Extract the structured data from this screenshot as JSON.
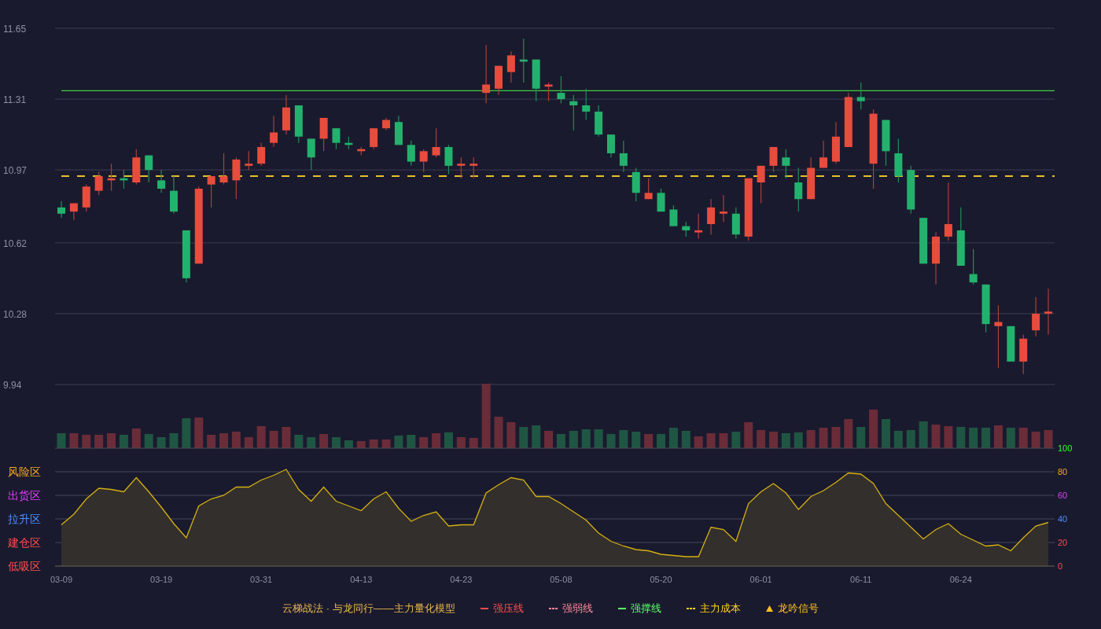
{
  "price_chart": {
    "chart_data": {
      "type": "candlestick",
      "grid": true,
      "ylim": [
        9.94,
        11.65
      ],
      "yticks": [
        11.65,
        11.31,
        10.97,
        10.62,
        10.28,
        9.94
      ],
      "ohlc": [
        [
          10.79,
          10.82,
          10.74,
          10.76
        ],
        [
          10.77,
          10.81,
          10.73,
          10.81
        ],
        [
          10.79,
          10.9,
          10.77,
          10.89
        ],
        [
          10.87,
          10.96,
          10.85,
          10.94
        ],
        [
          10.92,
          11.0,
          10.87,
          10.93
        ],
        [
          10.93,
          10.97,
          10.88,
          10.92
        ],
        [
          10.91,
          11.07,
          10.9,
          11.03
        ],
        [
          11.04,
          11.04,
          10.91,
          10.97
        ],
        [
          10.92,
          10.97,
          10.86,
          10.88
        ],
        [
          10.87,
          10.94,
          10.76,
          10.77
        ],
        [
          10.68,
          10.68,
          10.43,
          10.45
        ],
        [
          10.52,
          10.89,
          10.52,
          10.88
        ],
        [
          10.9,
          10.94,
          10.79,
          10.94
        ],
        [
          10.91,
          11.05,
          10.9,
          10.94
        ],
        [
          10.92,
          11.03,
          10.83,
          11.02
        ],
        [
          10.99,
          11.06,
          10.97,
          11.0
        ],
        [
          11.0,
          11.1,
          10.99,
          11.08
        ],
        [
          11.1,
          11.23,
          11.08,
          11.15
        ],
        [
          11.16,
          11.33,
          11.14,
          11.27
        ],
        [
          11.28,
          11.28,
          11.1,
          11.13
        ],
        [
          11.12,
          11.12,
          10.97,
          11.03
        ],
        [
          11.12,
          11.22,
          11.06,
          11.22
        ],
        [
          11.17,
          11.17,
          11.07,
          11.1
        ],
        [
          11.1,
          11.13,
          11.07,
          11.09
        ],
        [
          11.06,
          11.08,
          11.04,
          11.07
        ],
        [
          11.08,
          11.17,
          11.07,
          11.17
        ],
        [
          11.17,
          11.22,
          11.16,
          11.21
        ],
        [
          11.2,
          11.23,
          11.09,
          11.09
        ],
        [
          11.09,
          11.11,
          10.99,
          11.01
        ],
        [
          11.01,
          11.07,
          10.96,
          11.06
        ],
        [
          11.04,
          11.17,
          11.03,
          11.08
        ],
        [
          11.08,
          11.09,
          10.95,
          10.99
        ],
        [
          10.99,
          11.03,
          10.93,
          11.0
        ],
        [
          10.99,
          11.03,
          10.93,
          11.0
        ],
        [
          11.34,
          11.57,
          11.29,
          11.38
        ],
        [
          11.36,
          11.47,
          11.33,
          11.47
        ],
        [
          11.44,
          11.54,
          11.39,
          11.52
        ],
        [
          11.5,
          11.6,
          11.39,
          11.49
        ],
        [
          11.5,
          11.5,
          11.3,
          11.36
        ],
        [
          11.37,
          11.39,
          11.3,
          11.38
        ],
        [
          11.34,
          11.42,
          11.29,
          11.31
        ],
        [
          11.3,
          11.33,
          11.16,
          11.28
        ],
        [
          11.28,
          11.36,
          11.21,
          11.25
        ],
        [
          11.25,
          11.28,
          11.13,
          11.14
        ],
        [
          11.14,
          11.14,
          11.03,
          11.05
        ],
        [
          11.05,
          11.11,
          10.96,
          10.99
        ],
        [
          10.96,
          10.98,
          10.82,
          10.86
        ],
        [
          10.83,
          10.93,
          10.83,
          10.86
        ],
        [
          10.86,
          10.88,
          10.77,
          10.77
        ],
        [
          10.78,
          10.8,
          10.7,
          10.7
        ],
        [
          10.7,
          10.72,
          10.65,
          10.68
        ],
        [
          10.67,
          10.76,
          10.64,
          10.68
        ],
        [
          10.71,
          10.83,
          10.66,
          10.79
        ],
        [
          10.76,
          10.85,
          10.72,
          10.77
        ],
        [
          10.76,
          10.79,
          10.64,
          10.66
        ],
        [
          10.65,
          10.93,
          10.63,
          10.93
        ],
        [
          10.91,
          10.99,
          10.81,
          10.99
        ],
        [
          10.99,
          11.08,
          10.96,
          11.08
        ],
        [
          11.03,
          11.07,
          10.93,
          10.99
        ],
        [
          10.91,
          10.98,
          10.77,
          10.83
        ],
        [
          10.83,
          11.03,
          10.83,
          10.98
        ],
        [
          10.98,
          11.11,
          10.98,
          11.03
        ],
        [
          11.01,
          11.2,
          11.0,
          11.13
        ],
        [
          11.08,
          11.34,
          11.08,
          11.32
        ],
        [
          11.32,
          11.39,
          11.26,
          11.3
        ],
        [
          11.0,
          11.26,
          10.88,
          11.24
        ],
        [
          11.21,
          11.21,
          10.99,
          11.06
        ],
        [
          11.05,
          11.12,
          10.91,
          10.94
        ],
        [
          10.97,
          10.99,
          10.76,
          10.78
        ],
        [
          10.74,
          10.74,
          10.52,
          10.52
        ],
        [
          10.52,
          10.67,
          10.42,
          10.65
        ],
        [
          10.65,
          10.91,
          10.63,
          10.71
        ],
        [
          10.68,
          10.79,
          10.51,
          10.51
        ],
        [
          10.47,
          10.59,
          10.42,
          10.43
        ],
        [
          10.42,
          10.42,
          10.19,
          10.23
        ],
        [
          10.22,
          10.32,
          10.02,
          10.24
        ],
        [
          10.22,
          10.22,
          10.05,
          10.05
        ],
        [
          10.05,
          10.18,
          9.99,
          10.16
        ],
        [
          10.2,
          10.36,
          10.17,
          10.28
        ],
        [
          10.28,
          10.4,
          10.18,
          10.29
        ]
      ],
      "ref_lines": [
        {
          "axis": "y",
          "value": 11.35,
          "color": "#3fcf3f"
        },
        {
          "axis": "y",
          "value": 10.94,
          "color": "#e6c229"
        }
      ]
    }
  },
  "indicator_chart": {
    "zones": [
      {
        "label": "风险区",
        "color": "#f5a623"
      },
      {
        "label": "出货区",
        "color": "#e040fb"
      },
      {
        "label": "拉升区",
        "color": "#4a8cff"
      },
      {
        "label": "建仓区",
        "color": "#ff4d4d"
      },
      {
        "label": "低吸区",
        "color": "#ff4d4d"
      }
    ],
    "chart_data": {
      "type": "area",
      "grid": true,
      "ylim": [
        0,
        100
      ],
      "yticks": [
        100,
        80,
        60,
        40,
        20,
        0
      ],
      "categories": [
        "03-09",
        null,
        null,
        null,
        null,
        null,
        null,
        null,
        "03-19",
        null,
        null,
        null,
        null,
        null,
        null,
        null,
        "03-31",
        null,
        null,
        null,
        null,
        null,
        null,
        null,
        "04-13",
        null,
        null,
        null,
        null,
        null,
        null,
        null,
        "04-23",
        null,
        null,
        null,
        null,
        null,
        null,
        null,
        "05-08",
        null,
        null,
        null,
        null,
        null,
        null,
        null,
        "05-20",
        null,
        null,
        null,
        null,
        null,
        null,
        null,
        "06-01",
        null,
        null,
        null,
        null,
        null,
        null,
        null,
        "06-11",
        null,
        null,
        null,
        null,
        null,
        null,
        null,
        "06-24",
        null,
        null,
        null,
        null,
        null,
        null,
        null
      ],
      "series": [
        {
          "color": "#d4b012",
          "values": [
            35,
            44,
            57,
            66,
            65,
            63,
            75,
            63,
            50,
            36,
            24,
            51,
            57,
            60,
            67,
            67,
            73,
            77,
            82,
            65,
            55,
            67,
            55,
            51,
            47,
            57,
            63,
            49,
            38,
            43,
            46,
            34,
            35,
            35,
            62,
            69,
            75,
            73,
            59,
            59,
            53,
            46,
            39,
            28,
            21,
            17,
            14,
            13,
            10,
            9,
            8,
            8,
            33,
            31,
            21,
            53,
            63,
            70,
            62,
            48,
            59,
            64,
            71,
            79,
            78,
            70,
            53,
            43,
            33,
            23,
            31,
            36,
            27,
            22,
            17,
            18,
            13,
            24,
            34,
            37
          ]
        }
      ]
    }
  },
  "legend": {
    "title": "云梯战法 · 与龙同行——主力量化模型",
    "items": [
      {
        "kind": "solid",
        "label": "强压线",
        "color": "#ff4d4d"
      },
      {
        "kind": "dashed",
        "label": "强弱线",
        "color": "#ff8a9a"
      },
      {
        "kind": "solid",
        "label": "强撑线",
        "color": "#5cff6b"
      },
      {
        "kind": "dashed",
        "label": "主力成本",
        "color": "#ffd21f"
      },
      {
        "kind": "triangle",
        "label": "龙吟信号",
        "color": "#ffc21f"
      }
    ]
  }
}
